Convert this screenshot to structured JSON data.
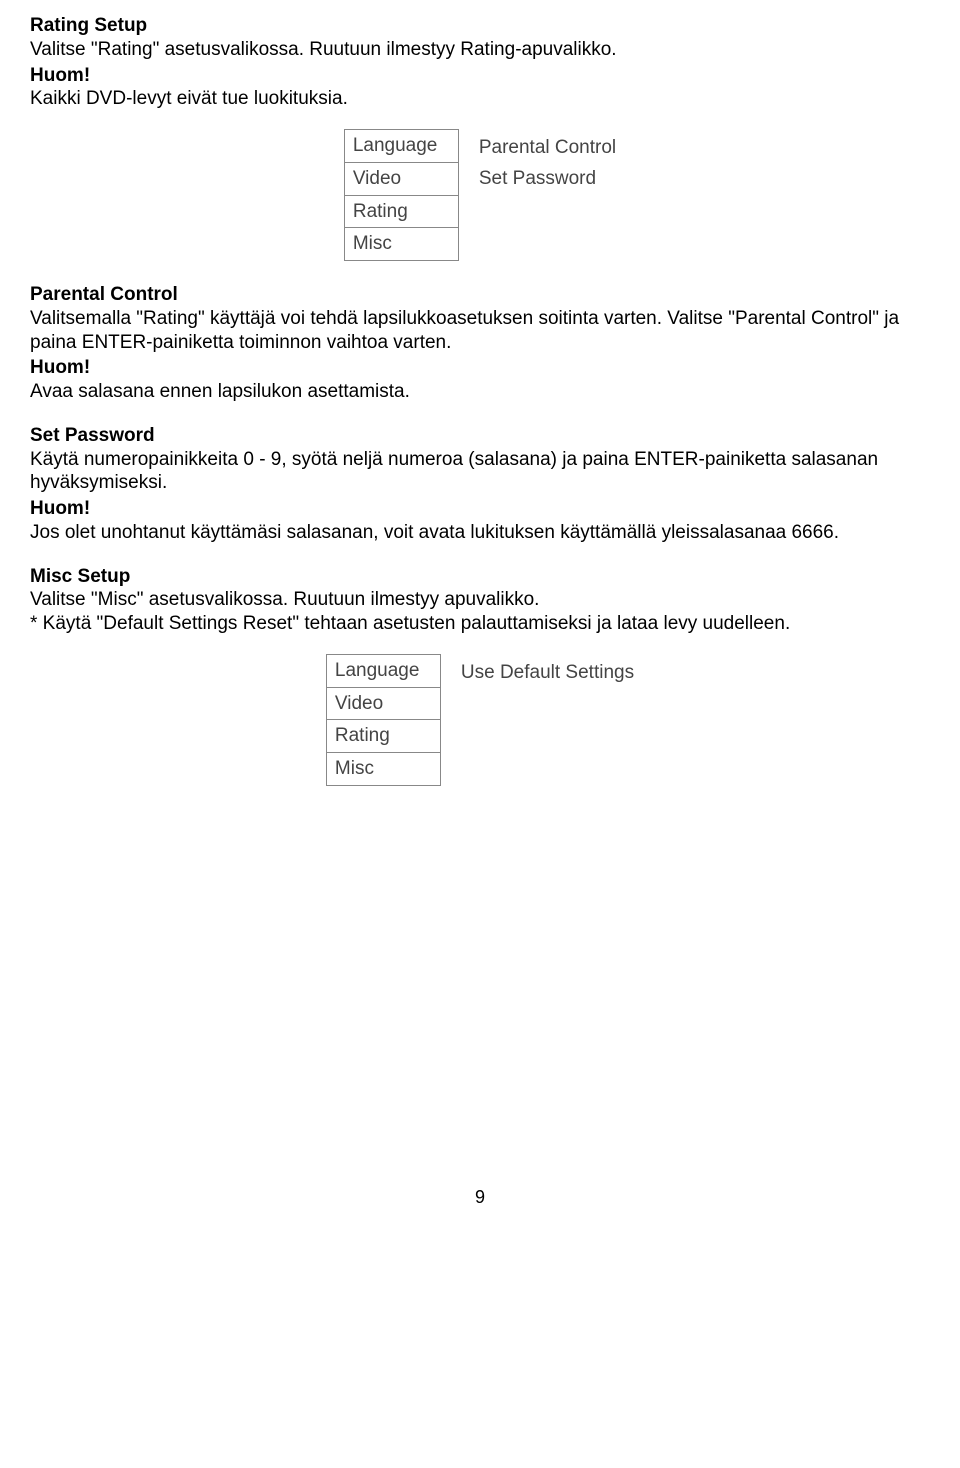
{
  "sections": {
    "rating_setup": {
      "title": "Rating Setup",
      "body": "Valitse \"Rating\" asetusvalikossa. Ruutuun ilmestyy Rating-apuvalikko.",
      "note_label": "Huom!",
      "note_body": "Kaikki DVD-levyt eivät tue luokituksia."
    },
    "parental_control": {
      "title": "Parental Control",
      "body": "Valitsemalla \"Rating\" käyttäjä voi tehdä lapsilukkoasetuksen soitinta varten. Valitse \"Parental Control\" ja paina ENTER-painiketta toiminnon vaihtoa varten.",
      "note_label": "Huom!",
      "note_body": "Avaa salasana ennen lapsilukon asettamista."
    },
    "set_password": {
      "title": "Set  Password",
      "body": "Käytä numeropainikkeita 0 - 9, syötä neljä numeroa (salasana) ja paina ENTER-painiketta salasanan hyväksymiseksi.",
      "note_label": "Huom!",
      "note_body": "Jos olet unohtanut käyttämäsi salasanan, voit avata lukituksen käyttämällä yleissalasanaa 6666."
    },
    "misc_setup": {
      "title": "Misc Setup",
      "body": "Valitse \"Misc\" asetusvalikossa. Ruutuun ilmestyy apuvalikko.",
      "bullet": "*   Käytä \"Default Settings Reset\" tehtaan asetusten palauttamiseksi ja lataa levy uudelleen."
    }
  },
  "menu1": {
    "left": [
      "Language",
      "Video",
      "Rating",
      "Misc"
    ],
    "right": [
      "Parental Control",
      "Set Password"
    ]
  },
  "menu2": {
    "left": [
      "Language",
      "Video",
      "Rating",
      "Misc"
    ],
    "right": [
      "Use Default Settings"
    ]
  },
  "page_number": "9"
}
